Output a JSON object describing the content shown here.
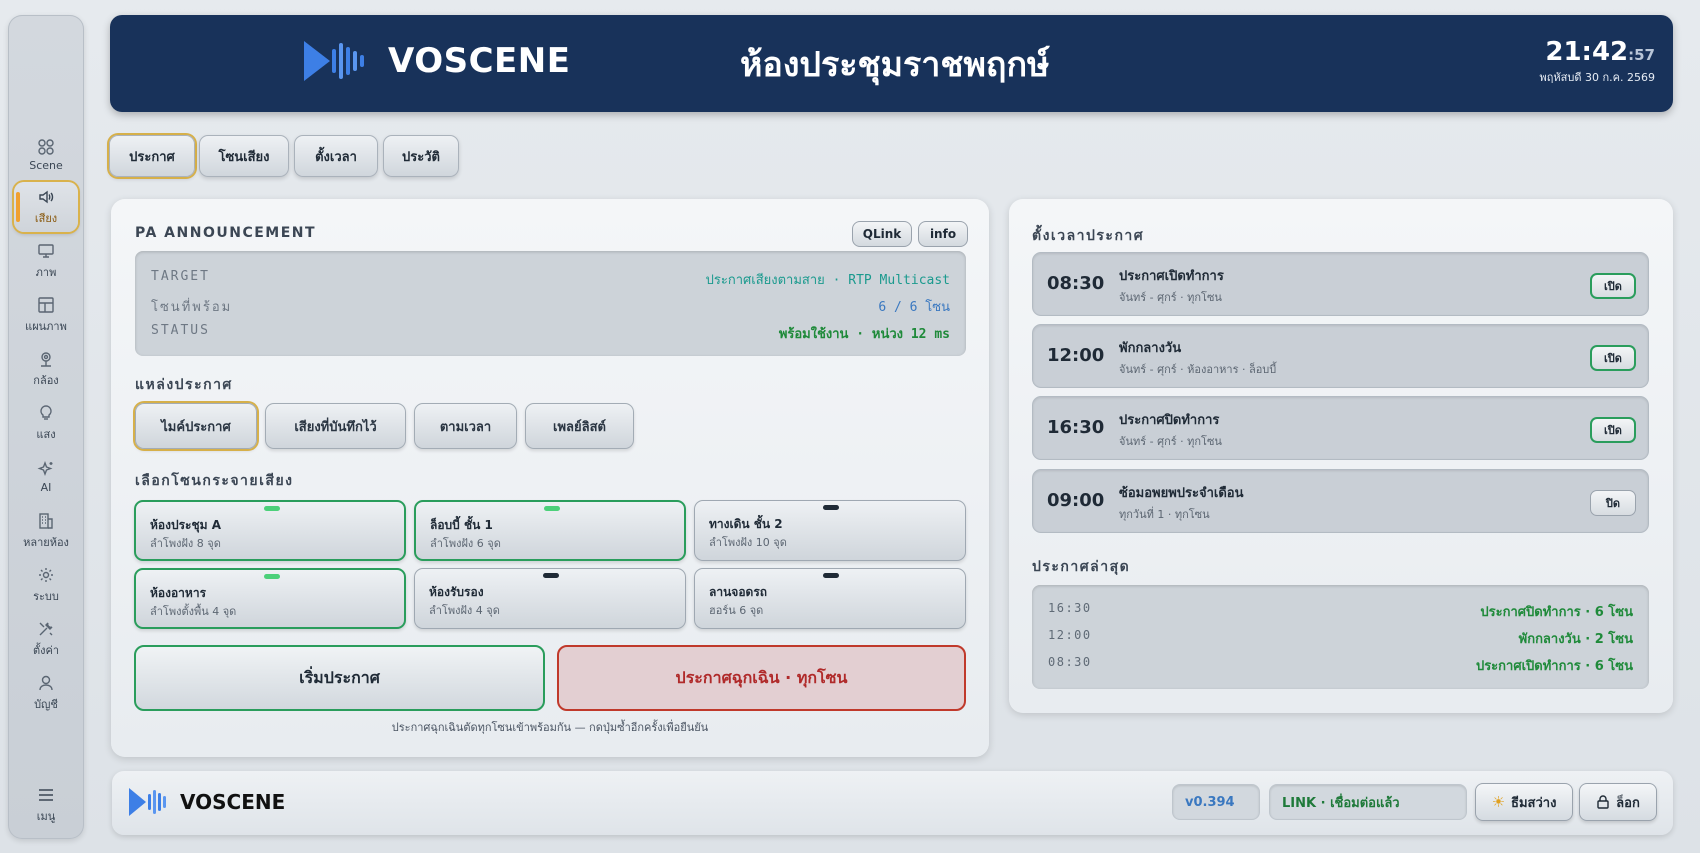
{
  "sidebar": {
    "items": [
      {
        "label": "Scene",
        "icon": "grid-icon"
      },
      {
        "label": "เสียง",
        "icon": "speaker-icon"
      },
      {
        "label": "ภาพ",
        "icon": "monitor-icon"
      },
      {
        "label": "แผนภาพ",
        "icon": "layout-icon"
      },
      {
        "label": "กล้อง",
        "icon": "camera-icon"
      },
      {
        "label": "แสง",
        "icon": "bulb-icon"
      },
      {
        "label": "AI",
        "icon": "sparkle-icon"
      },
      {
        "label": "หลายห้อง",
        "icon": "building-icon"
      },
      {
        "label": "ระบบ",
        "icon": "gear-icon"
      },
      {
        "label": "ตั้งค่า",
        "icon": "tools-icon"
      },
      {
        "label": "บัญชี",
        "icon": "user-icon"
      }
    ],
    "menu_label": "เมนู",
    "active_index": 1
  },
  "header": {
    "brand": "VOSCENE",
    "title": "ห้องประชุมราชพฤกษ์",
    "time": "21:42",
    "seconds": ":57",
    "date": "พฤหัสบดี 30 ก.ค. 2569"
  },
  "tabs": [
    "ประกาศ",
    "โซนเสียง",
    "ตั้งเวลา",
    "ประวัติ"
  ],
  "pa": {
    "title": "PA ANNOUNCEMENT",
    "qlink_label": "QLink",
    "info_label": "info",
    "rows": [
      {
        "key": "TARGET",
        "value": "ประกาศเสียงตามสาย · RTP Multicast",
        "color": "#1b9a8e"
      },
      {
        "key": "โซนที่พร้อม",
        "value": "6 / 6 โซน",
        "color": "#3a78c0"
      },
      {
        "key": "STATUS",
        "value": "พร้อมใช้งาน · หน่วง 12 ms",
        "color": "#1f8a3a"
      }
    ],
    "source_title": "แหล่งประกาศ",
    "sources": [
      "ไมค์ประกาศ",
      "เสียงที่บันทึกไว้",
      "ตามเวลา",
      "เพลย์ลิสต์"
    ],
    "zone_title": "เลือกโซนกระจายเสียง",
    "zones": [
      {
        "name": "ห้องประชุม A",
        "sub": "ลำโพงฝัง 8 จุด",
        "on": true
      },
      {
        "name": "ล็อบบี้ ชั้น 1",
        "sub": "ลำโพงฝัง 6 จุด",
        "on": true
      },
      {
        "name": "ทางเดิน ชั้น 2",
        "sub": "ลำโพงฝัง 10 จุด",
        "on": false
      },
      {
        "name": "ห้องอาหาร",
        "sub": "ลำโพงตั้งพื้น 4 จุด",
        "on": true
      },
      {
        "name": "ห้องรับรอง",
        "sub": "ลำโพงฝัง 4 จุด",
        "on": false
      },
      {
        "name": "ลานจอดรถ",
        "sub": "ฮอร์น 6 จุด",
        "on": false
      }
    ],
    "start_label": "เริ่มประกาศ",
    "emergency_label": "ประกาศฉุกเฉิน · ทุกโซน",
    "hint": "ประกาศฉุกเฉินตัดทุกโซนเข้าพร้อมกัน — กดปุ่มซ้ำอีกครั้งเพื่อยืนยัน"
  },
  "schedule": {
    "title": "ตั้งเวลาประกาศ",
    "items": [
      {
        "time": "08:30",
        "title": "ประกาศเปิดทำการ",
        "sub": "จันทร์ - ศุกร์ · ทุกโซน",
        "btn": "เปิด",
        "on": true
      },
      {
        "time": "12:00",
        "title": "พักกลางวัน",
        "sub": "จันทร์ - ศุกร์ · ห้องอาหาร · ล็อบบี้",
        "btn": "เปิด",
        "on": true
      },
      {
        "time": "16:30",
        "title": "ประกาศปิดทำการ",
        "sub": "จันทร์ - ศุกร์ · ทุกโซน",
        "btn": "เปิด",
        "on": true
      },
      {
        "time": "09:00",
        "title": "ซ้อมอพยพประจำเดือน",
        "sub": "ทุกวันที่ 1 · ทุกโซน",
        "btn": "ปิด",
        "on": false
      }
    ],
    "recent_title": "ประกาศล่าสุด",
    "recent": [
      {
        "time": "16:30",
        "text": "ประกาศปิดทำการ · 6 โซน"
      },
      {
        "time": "12:00",
        "text": "พักกลางวัน · 2 โซน"
      },
      {
        "time": "08:30",
        "text": "ประกาศเปิดทำการ · 6 โซน"
      }
    ]
  },
  "footer": {
    "brand": "VOSCENE",
    "version": "v0.394",
    "link": "LINK · เชื่อมต่อแล้ว",
    "theme_label": "ธีมสว่าง",
    "lock_label": "ล็อก"
  },
  "colors": {
    "header_bg": "#18325a",
    "brand_blue": "#3d7fe6",
    "accent_gold": "#d6b04a",
    "ok_green": "#2a9d5c",
    "emergency_red": "#c0392b"
  }
}
